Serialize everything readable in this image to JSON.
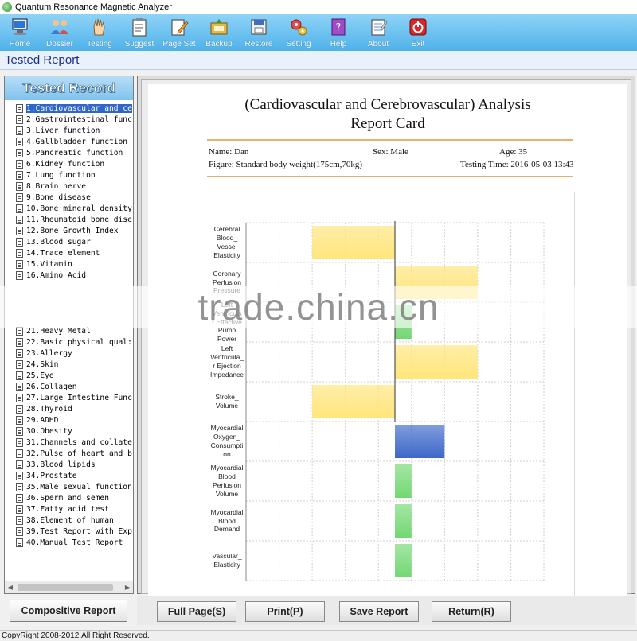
{
  "window": {
    "title": "Quantum Resonance Magnetic Analyzer"
  },
  "toolbar": {
    "items": [
      {
        "label": "Home",
        "icon": "home-monitor-icon"
      },
      {
        "label": "Dossier",
        "icon": "people-icon"
      },
      {
        "label": "Testing",
        "icon": "hand-icon"
      },
      {
        "label": "Suggest",
        "icon": "clipboard-icon"
      },
      {
        "label": "Page Set",
        "icon": "page-pen-icon"
      },
      {
        "label": "Backup",
        "icon": "backup-icon"
      },
      {
        "label": "Restore",
        "icon": "restore-icon"
      },
      {
        "label": "Setting",
        "icon": "gears-icon"
      },
      {
        "label": "Help",
        "icon": "help-book-icon"
      },
      {
        "label": "About",
        "icon": "about-notepad-icon"
      },
      {
        "label": "Exit",
        "icon": "power-icon"
      }
    ]
  },
  "section": {
    "title": "Tested Report"
  },
  "sidebar": {
    "title": "Tested Record",
    "items": [
      "1.Cardiovascular and ce",
      "2.Gastrointestinal func",
      "3.Liver function",
      "4.Gallbladder function",
      "5.Pancreatic function",
      "6.Kidney function",
      "7.Lung function",
      "8.Brain nerve",
      "9.Bone disease",
      "10.Bone mineral density",
      "11.Rheumatoid bone dise",
      "12.Bone Growth Index",
      "13.Blood sugar",
      "14.Trace element",
      "15.Vitamin",
      "16.Amino Acid",
      "21.Heavy Metal",
      "22.Basic physical qual:",
      "23.Allergy",
      "24.Skin",
      "25.Eye",
      "26.Collagen",
      "27.Large Intestine Func",
      "28.Thyroid",
      "29.ADHD",
      "30.Obesity",
      "31.Channels and collate",
      "32.Pulse of heart and b",
      "33.Blood lipids",
      "34.Prostate",
      "35.Male sexual function",
      "36.Sperm and semen",
      "37.Fatty acid test",
      "38.Element of human",
      "39.Test Report with Exp",
      "40.Manual Test Report"
    ],
    "selected_index": 0,
    "button": "Compositive Report"
  },
  "report": {
    "title_line1": "(Cardiovascular and Cerebrovascular) Analysis",
    "title_line2": "Report Card",
    "name": "Name: Dan",
    "sex": "Sex: Male",
    "age": "Age: 35",
    "figure": "Figure: Standard body weight(175cm,70kg)",
    "testing_time": "Testing Time: 2016-05-03 13:43"
  },
  "chart_data": {
    "type": "bar",
    "orientation": "horizontal",
    "categories": [
      "Cerebral_Blood_Vessel_Elasticity",
      "Coronary_Perfusion_Pressure",
      "Left_Ventricula_r Effective_Pump_Power",
      "Left_Ventricula_r Ejection_Impedance",
      "Stroke_Volume",
      "Myocardial_Oxygen_Consumption",
      "Myocardial_Blood_Perfusion_Volume",
      "Myocardial_Blood_Demand",
      "Vascular_Elasticity"
    ],
    "category_display": [
      [
        "Cerebral",
        "Blood_",
        "Vessel",
        "Elasticity"
      ],
      [
        "Coronary",
        "Perfusion",
        "Pressure"
      ],
      [
        "Left",
        "Ventricula",
        "r Effective",
        "Pump",
        "Power"
      ],
      [
        "Left",
        "Ventricula_",
        "r Ejection",
        "Impedance"
      ],
      [
        "Stroke_",
        "Volume"
      ],
      [
        "Myocardial",
        "Oxygen_",
        "Consumpti",
        "on"
      ],
      [
        "Myocardial",
        "Blood",
        "Perfusion",
        "Volume"
      ],
      [
        "Myocardial",
        "Blood",
        "Demand"
      ],
      [
        "Vascular_",
        "Elasticity"
      ]
    ],
    "values": [
      -2.5,
      2.5,
      0.5,
      2.5,
      -2.5,
      1.5,
      0.5,
      0.5,
      0.5
    ],
    "bar_colors": [
      "#ffe57a",
      "#ffe57a",
      "#73d873",
      "#ffe57a",
      "#ffe57a",
      "#3d68c8",
      "#73d873",
      "#73d873",
      "#73d873"
    ],
    "xlim": [
      -4.5,
      4.5
    ],
    "grid": true,
    "title": "",
    "xlabel": "",
    "ylabel": ""
  },
  "buttons": {
    "full_page": "Full Page(S)",
    "print": "Print(P)",
    "save_report": "Save Report",
    "return": "Return(R)"
  },
  "status": {
    "copyright": "CopyRight 2008-2012,All Right Reserved."
  },
  "watermark": {
    "text": "trade.china.cn"
  }
}
